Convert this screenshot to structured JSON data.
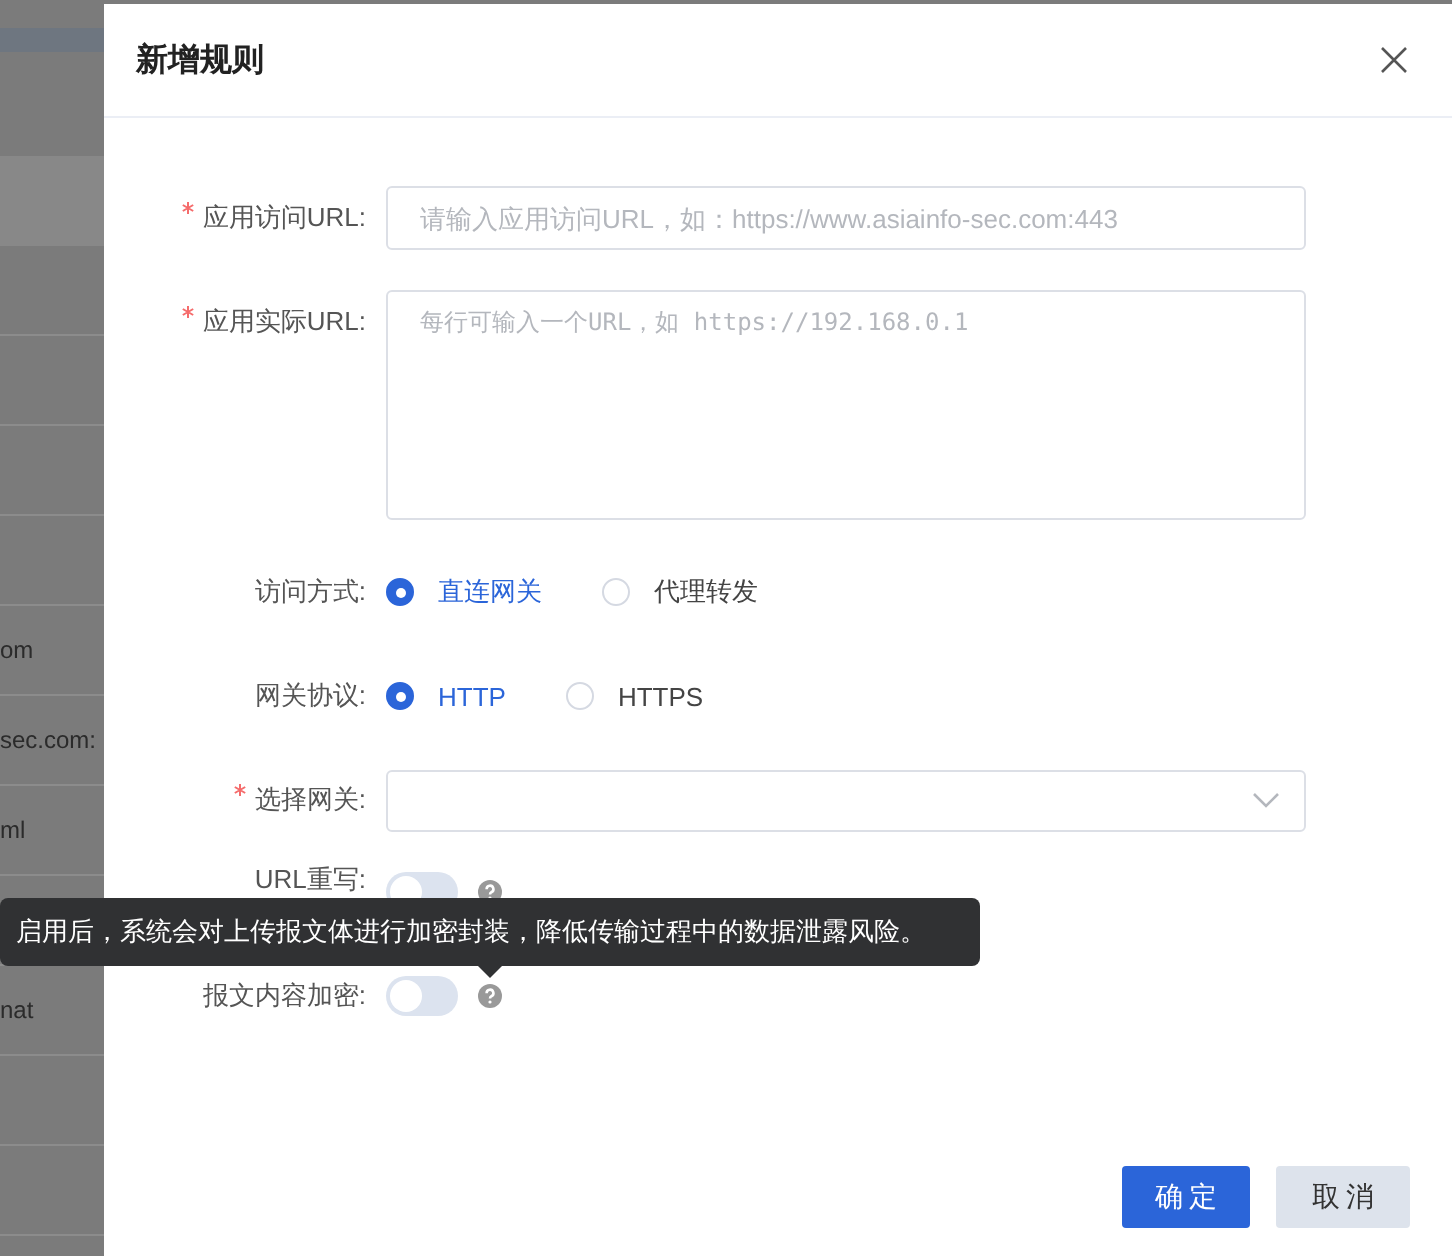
{
  "background_table": {
    "rows": [
      {},
      {},
      {},
      {},
      {
        "text": "om"
      },
      {
        "text": "sec.com:"
      },
      {
        "text": "ml"
      },
      {},
      {
        "text": "nat"
      },
      {},
      {}
    ]
  },
  "dialog": {
    "title": "新增规则",
    "fields": [
      {
        "kind": "input",
        "label": "应用访问URL:",
        "required": true,
        "placeholder": "请输入应用访问URL，如：https://www.asiainfo-sec.com:443"
      },
      {
        "kind": "textarea",
        "label": "应用实际URL:",
        "required": true,
        "placeholder": "每行可输入一个URL，如 https://192.168.0.1"
      },
      {
        "kind": "radio",
        "label": "访问方式:",
        "required": false,
        "options": [
          {
            "label": "直连网关",
            "selected": true
          },
          {
            "label": "代理转发",
            "selected": false
          }
        ]
      },
      {
        "kind": "radio",
        "label": "网关协议:",
        "required": false,
        "options": [
          {
            "label": "HTTP",
            "selected": true
          },
          {
            "label": "HTTPS",
            "selected": false
          }
        ]
      },
      {
        "kind": "select",
        "label": "选择网关:",
        "required": true
      },
      {
        "kind": "switch",
        "label": "URL重写:",
        "required": false,
        "on": false
      },
      {
        "kind": "switch",
        "label": "报文内容加密:",
        "required": false,
        "on": false
      }
    ],
    "tooltip": "启用后，系统会对上传报文体进行加密封装，降低传输过程中的数据泄露风险。",
    "buttons": [
      {
        "label": "确定",
        "kind": "primary"
      },
      {
        "label": "取消",
        "kind": "secondary"
      }
    ]
  }
}
